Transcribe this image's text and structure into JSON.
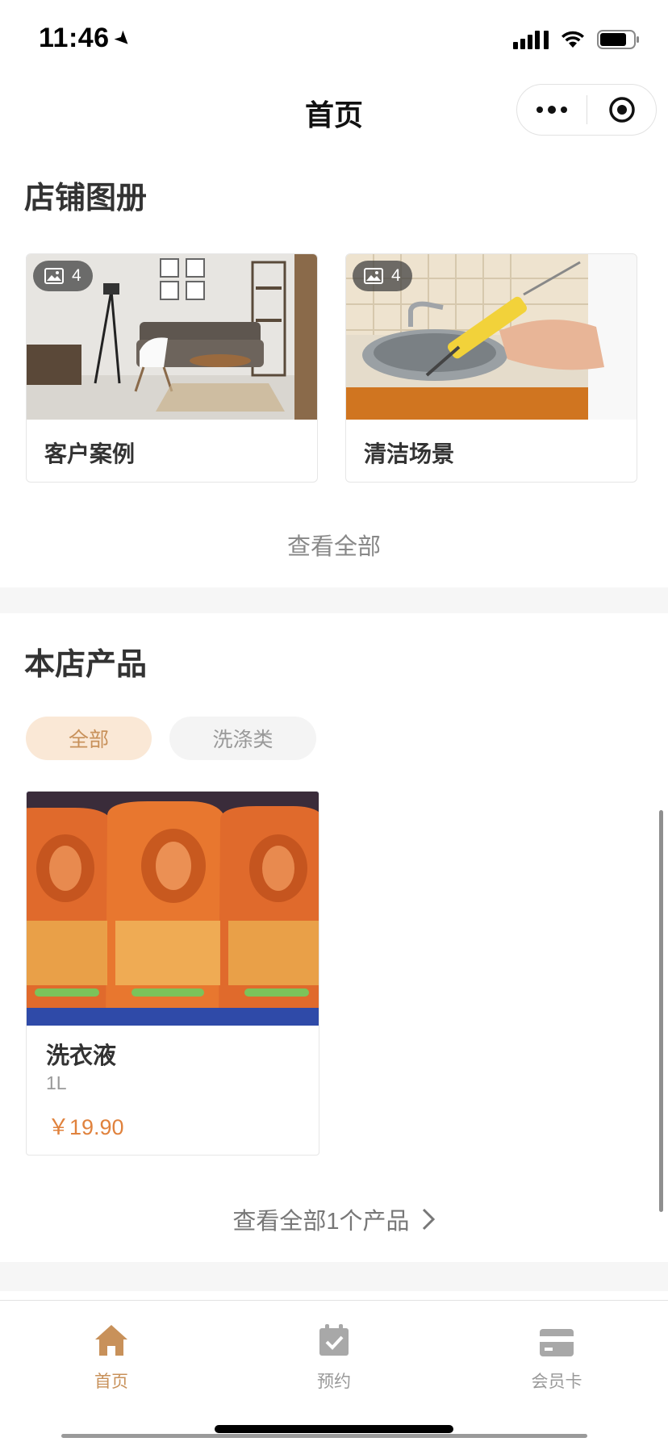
{
  "status_bar": {
    "time": "11:46"
  },
  "nav": {
    "title": "首页"
  },
  "album_section": {
    "title": "店铺图册",
    "albums": [
      {
        "label": "客户案例",
        "count": "4"
      },
      {
        "label": "清洁场景",
        "count": "4"
      }
    ],
    "view_all": "查看全部"
  },
  "product_section": {
    "title": "本店产品",
    "tabs": [
      {
        "label": "全部",
        "active": true
      },
      {
        "label": "洗涤类",
        "active": false
      }
    ],
    "products": [
      {
        "name": "洗衣液",
        "spec": "1L",
        "price": "￥19.90"
      }
    ],
    "view_all": "查看全部1个产品"
  },
  "tab_bar": {
    "items": [
      {
        "label": "首页",
        "icon": "home-icon",
        "active": true
      },
      {
        "label": "预约",
        "icon": "calendar-check-icon",
        "active": false
      },
      {
        "label": "会员卡",
        "icon": "card-icon",
        "active": false
      }
    ]
  },
  "colors": {
    "accent": "#c8915a",
    "price": "#e0823d",
    "tab_active_bg": "#fae8d6",
    "inactive": "#999999"
  }
}
